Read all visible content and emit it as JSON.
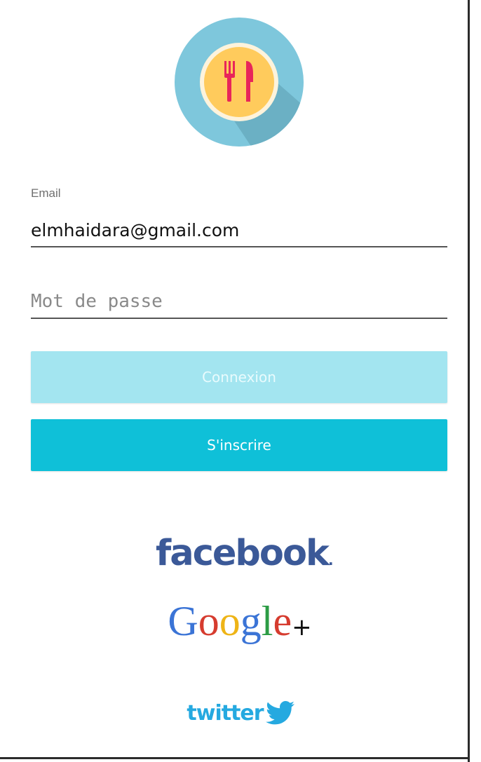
{
  "logo": {
    "icon": "fork-knife-icon",
    "colors": {
      "outer": "#7ec7dc",
      "inner": "#ffcb5c",
      "utensils": "#e8255a"
    }
  },
  "form": {
    "email_label": "Email",
    "email_value": "elmhaidara@gmail.com",
    "password_placeholder": "Mot de passe",
    "login_label": "Connexion",
    "signup_label": "S'inscrire"
  },
  "social": {
    "facebook": "facebook",
    "facebook_dot": ".",
    "google_letters": [
      "G",
      "o",
      "o",
      "g",
      "l",
      "e"
    ],
    "google_plus": "+",
    "twitter": "twitter"
  },
  "colors": {
    "login_button": "#a3e5f0",
    "signup_button": "#0fc0d8",
    "facebook": "#3b5998",
    "twitter": "#25a9e0"
  }
}
